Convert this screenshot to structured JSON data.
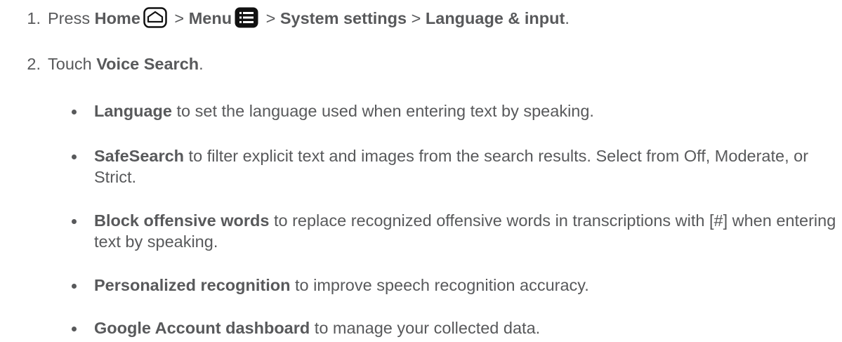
{
  "steps": [
    {
      "number": "1.",
      "prefix": "Press ",
      "home_label": "Home",
      "sep1": " > ",
      "menu_label": "Menu",
      "sep2": " > ",
      "system_settings_label": "System settings",
      "sep3": " > ",
      "language_input_label": "Language & input",
      "suffix": ".",
      "icons": [
        "home-icon",
        "menu-icon"
      ]
    },
    {
      "number": "2.",
      "prefix": "Touch ",
      "voice_search_label": "Voice Search",
      "suffix": "."
    }
  ],
  "bullets": [
    {
      "term": "Language",
      "description": " to set the language used when entering text by speaking."
    },
    {
      "term": "SafeSearch",
      "description": " to filter explicit text and images from the search results. Select from Off, Moderate, or Strict."
    },
    {
      "term": "Block offensive words",
      "description": " to replace recognized offensive words in transcriptions with [#] when entering text by speaking."
    },
    {
      "term": "Personalized recognition",
      "description": " to improve speech recognition accuracy."
    },
    {
      "term": "Google Account dashboard",
      "description": " to manage your collected data."
    }
  ]
}
